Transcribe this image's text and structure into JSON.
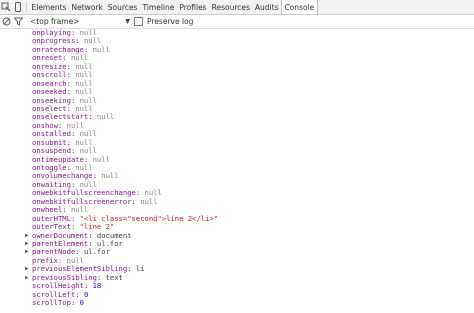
{
  "tabs": [
    "Elements",
    "Network",
    "Sources",
    "Timeline",
    "Profiles",
    "Resources",
    "Audits",
    "Console"
  ],
  "active_tab": "Console",
  "toolbar": {
    "frame_label": "<top frame>",
    "preserve_log_label": "Preserve log"
  },
  "rows": [
    {
      "key": "onplaying",
      "value": "null",
      "type": "null",
      "expand": false
    },
    {
      "key": "onprogress",
      "value": "null",
      "type": "null",
      "expand": false
    },
    {
      "key": "onratechange",
      "value": "null",
      "type": "null",
      "expand": false
    },
    {
      "key": "onreset",
      "value": "null",
      "type": "null",
      "expand": false
    },
    {
      "key": "onresize",
      "value": "null",
      "type": "null",
      "expand": false
    },
    {
      "key": "onscroll",
      "value": "null",
      "type": "null",
      "expand": false
    },
    {
      "key": "onsearch",
      "value": "null",
      "type": "null",
      "expand": false
    },
    {
      "key": "onseeked",
      "value": "null",
      "type": "null",
      "expand": false
    },
    {
      "key": "onseeking",
      "value": "null",
      "type": "null",
      "expand": false
    },
    {
      "key": "onselect",
      "value": "null",
      "type": "null",
      "expand": false
    },
    {
      "key": "onselectstart",
      "value": "null",
      "type": "null",
      "expand": false
    },
    {
      "key": "onshow",
      "value": "null",
      "type": "null",
      "expand": false
    },
    {
      "key": "onstalled",
      "value": "null",
      "type": "null",
      "expand": false
    },
    {
      "key": "onsubmit",
      "value": "null",
      "type": "null",
      "expand": false
    },
    {
      "key": "onsuspend",
      "value": "null",
      "type": "null",
      "expand": false
    },
    {
      "key": "ontimeupdate",
      "value": "null",
      "type": "null",
      "expand": false
    },
    {
      "key": "ontoggle",
      "value": "null",
      "type": "null",
      "expand": false
    },
    {
      "key": "onvolumechange",
      "value": "null",
      "type": "null",
      "expand": false
    },
    {
      "key": "onwaiting",
      "value": "null",
      "type": "null",
      "expand": false
    },
    {
      "key": "onwebkitfullscreenchange",
      "value": "null",
      "type": "null",
      "expand": false
    },
    {
      "key": "onwebkitfullscreenerror",
      "value": "null",
      "type": "null",
      "expand": false
    },
    {
      "key": "onwheel",
      "value": "null",
      "type": "null",
      "expand": false
    },
    {
      "key": "outerHTML",
      "value": "\"<li class=\"second\">line 2</li>\"",
      "type": "string",
      "expand": false
    },
    {
      "key": "outerText",
      "value": "\"line 2\"",
      "type": "string",
      "expand": false
    },
    {
      "key": "ownerDocument",
      "value": "document",
      "type": "object",
      "expand": true
    },
    {
      "key": "parentElement",
      "value": "ul.for",
      "type": "object",
      "expand": true
    },
    {
      "key": "parentNode",
      "value": "ul.for",
      "type": "object",
      "expand": true
    },
    {
      "key": "prefix",
      "value": "null",
      "type": "null",
      "expand": false
    },
    {
      "key": "previousElementSibling",
      "value": "li",
      "type": "object",
      "expand": true
    },
    {
      "key": "previousSibling",
      "value": "text",
      "type": "object",
      "expand": true
    },
    {
      "key": "scrollHeight",
      "value": "18",
      "type": "number",
      "expand": false
    },
    {
      "key": "scrollLeft",
      "value": "0",
      "type": "number",
      "expand": false
    },
    {
      "key": "scrollTop",
      "value": "0",
      "type": "number",
      "expand": false
    }
  ]
}
